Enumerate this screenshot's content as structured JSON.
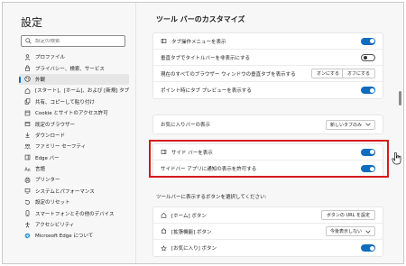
{
  "sidebar": {
    "title": "設定",
    "search_placeholder": "設定の検索",
    "items": [
      {
        "label": "プロファイル",
        "icon": "person-icon",
        "active": false
      },
      {
        "label": "プライバシー、検索、サービス",
        "icon": "lock-icon",
        "active": false
      },
      {
        "label": "外観",
        "icon": "palette-icon",
        "active": true
      },
      {
        "label": "[スタート]、[ホーム]、および [新規] タブ",
        "icon": "home-icon",
        "active": false
      },
      {
        "label": "共有、コピーして貼り付け",
        "icon": "share-icon",
        "active": false
      },
      {
        "label": "Cookie とサイトのアクセス許可",
        "icon": "cookie-icon",
        "active": false
      },
      {
        "label": "既定のブラウザー",
        "icon": "browser-icon",
        "active": false
      },
      {
        "label": "ダウンロード",
        "icon": "download-icon",
        "active": false
      },
      {
        "label": "ファミリー セーフティ",
        "icon": "family-icon",
        "active": false
      },
      {
        "label": "Edge バー",
        "icon": "edge-bar-icon",
        "active": false
      },
      {
        "label": "言語",
        "icon": "language-icon",
        "active": false
      },
      {
        "label": "プリンター",
        "icon": "printer-icon",
        "active": false
      },
      {
        "label": "システムとパフォーマンス",
        "icon": "system-icon",
        "active": false
      },
      {
        "label": "設定のリセット",
        "icon": "reset-icon",
        "active": false
      },
      {
        "label": "スマートフォンとその他のデバイス",
        "icon": "phone-icon",
        "active": false
      },
      {
        "label": "アクセシビリティ",
        "icon": "accessibility-icon",
        "active": false
      },
      {
        "label": "Microsoft Edge について",
        "icon": "edge-logo-icon",
        "active": false
      }
    ]
  },
  "main": {
    "section_title": "ツール バーのカスタマイズ",
    "tab_card": {
      "rows": [
        {
          "label": "タブ操作メニューを表示",
          "icon": "tab-actions-icon",
          "toggle": "on"
        },
        {
          "label": "垂直タブでタイトルバーを非表示にする",
          "icon": "",
          "toggle": "off"
        },
        {
          "label": "現在のすべてのブラウザー ウィンドウの垂直タブを表示する",
          "icon": "",
          "btn_on": "オンにする",
          "btn_off": "オフにする"
        },
        {
          "label": "ポイント時にタブ プレビューを表示する",
          "icon": "",
          "toggle": "on"
        }
      ]
    },
    "favorites_card": {
      "label": "お気に入りバーの表示",
      "select_value": "新しいタブのみ"
    },
    "sidebar_card": {
      "rows": [
        {
          "label": "サイド バーを表示",
          "icon": "sidebar-icon",
          "toggle": "on"
        },
        {
          "label": "サイドバー アプリに通知の表示を許可する",
          "icon": "",
          "toggle": "on"
        }
      ]
    },
    "toolbar_heading": "ツールバーに表示するボタンを選択してください:",
    "toolbar_card": {
      "rows": [
        {
          "label": "[ホーム] ボタン",
          "icon": "home-icon",
          "button": "ボタンの URL を設定"
        },
        {
          "label": "[拡張機能] ボタン",
          "icon": "extensions-icon",
          "select": "今後表示しない"
        },
        {
          "label": "[お気に入り] ボタン",
          "icon": "favorites-icon",
          "toggle": "on"
        }
      ]
    }
  },
  "colors": {
    "accent": "#0f6cbd",
    "highlight_border": "#d6191c",
    "background": "#f7f7f7"
  }
}
